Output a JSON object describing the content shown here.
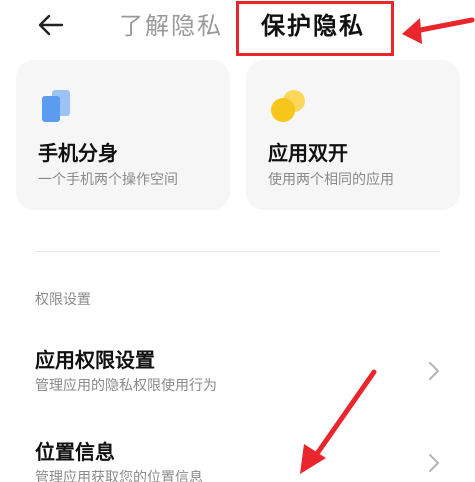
{
  "header": {
    "back_icon": "arrow-left-icon",
    "tabs": [
      {
        "label": "了解隐私",
        "active": false
      },
      {
        "label": "保护隐私",
        "active": true
      }
    ]
  },
  "cards": [
    {
      "title": "手机分身",
      "subtitle": "一个手机两个操作空间",
      "icon": "stacked-squares-icon",
      "icon_color": "#5b9bf0"
    },
    {
      "title": "应用双开",
      "subtitle": "使用两个相同的应用",
      "icon": "twin-circles-icon",
      "icon_color": "#f7c61a"
    }
  ],
  "section": {
    "label": "权限设置"
  },
  "list": [
    {
      "title": "应用权限设置",
      "subtitle": "管理应用的隐私权限使用行为"
    },
    {
      "title": "位置信息",
      "subtitle": "管理应用获取您的位置信息"
    }
  ],
  "colors": {
    "annotation_red": "#e8262b",
    "card_bg": "#f6f6f6",
    "muted_text": "#8a8a8a"
  }
}
